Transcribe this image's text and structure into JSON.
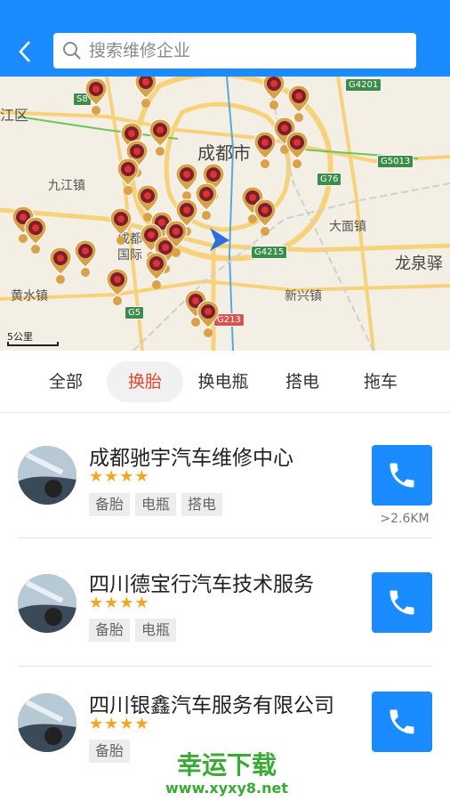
{
  "header": {
    "search_placeholder": "搜索维修企业"
  },
  "map": {
    "labels": {
      "chengdu": "成都市",
      "jiujiang": "九江镇",
      "dami": "大面镇",
      "longquan": "龙泉驿",
      "huangshui": "黄水镇",
      "xinxing": "新兴镇",
      "district_left": "江区",
      "airport": "成都\n国际"
    },
    "roads": {
      "s8": "S8",
      "g4201": "G4201",
      "g5013": "G5013",
      "g76": "G76",
      "g4215": "G4215",
      "g5": "G5",
      "g213": "G213"
    },
    "scale_label": "5公里"
  },
  "tabs": [
    {
      "label": "全部",
      "active": false
    },
    {
      "label": "换胎",
      "active": true
    },
    {
      "label": "换电瓶",
      "active": false
    },
    {
      "label": "搭电",
      "active": false
    },
    {
      "label": "拖车",
      "active": false
    }
  ],
  "shops": [
    {
      "name": "成都驰宇汽车维修中心",
      "stars": "★★★★",
      "tags": [
        "备胎",
        "电瓶",
        "搭电"
      ],
      "distance": ">2.6KM"
    },
    {
      "name": "四川德宝行汽车技术服务",
      "stars": "★★★★",
      "tags": [
        "备胎",
        "电瓶"
      ]
    },
    {
      "name": "四川银鑫汽车服务有限公司",
      "stars": "★★★★",
      "tags": [
        "备胎"
      ]
    }
  ],
  "watermark": {
    "title": "幸运下载",
    "url": "www.xyxy8.net"
  },
  "colors": {
    "header_blue": "#1a8cff",
    "active_tab": "#e8452c",
    "star": "#f5a623",
    "pin": "#d9a24a"
  }
}
